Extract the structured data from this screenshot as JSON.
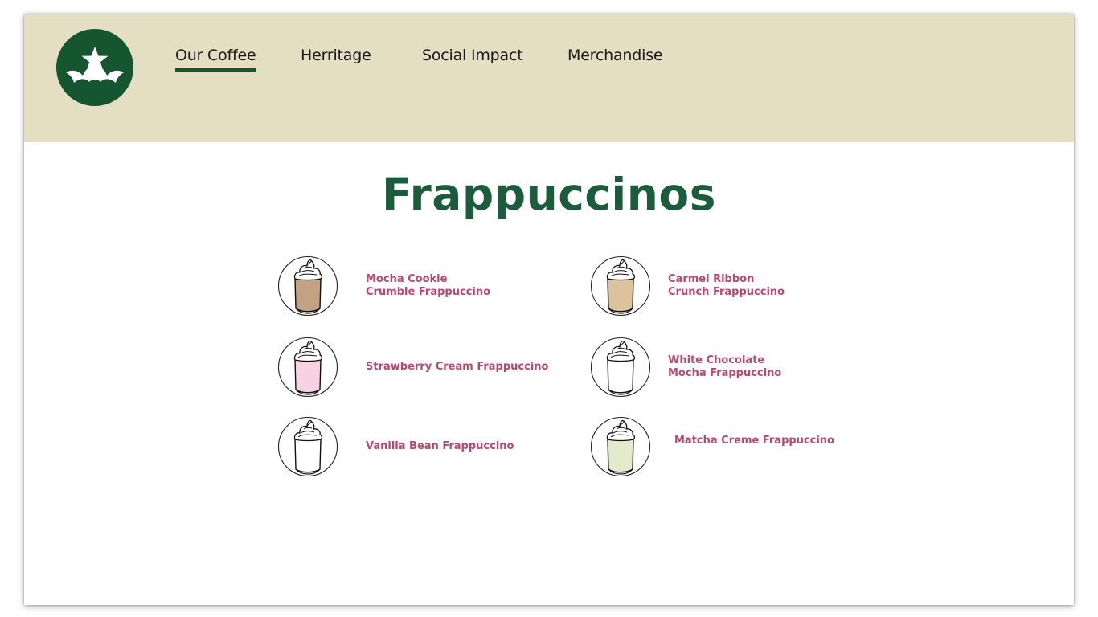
{
  "colors": {
    "header_bg": "#e4dfc2",
    "brand_green": "#155530",
    "title_green": "#1c5c3c",
    "drink_label": "#b44a6e"
  },
  "logo": {
    "icon": "crown-star-logo-icon"
  },
  "nav": {
    "items": [
      {
        "label": "Our Coffee",
        "active": true
      },
      {
        "label": "Herritage",
        "active": false
      },
      {
        "label": "Social Impact",
        "active": false
      },
      {
        "label": "Merchandise",
        "active": false
      }
    ]
  },
  "main": {
    "title": "Frappuccinos",
    "drinks": [
      {
        "line1": "Mocha Cookie",
        "line2": "Crumble Frappuccino",
        "fill": "#c3a283",
        "icon": "frappuccino-cup-icon"
      },
      {
        "line1": "Carmel Ribbon",
        "line2": "Crunch Frappuccino",
        "fill": "#dcc39c",
        "icon": "frappuccino-cup-icon"
      },
      {
        "line1": "Strawberry Cream Frappuccino",
        "line2": "",
        "fill": "#f7d3e2",
        "icon": "frappuccino-cup-icon"
      },
      {
        "line1": "White Chocolate",
        "line2": "Mocha Frappuccino",
        "fill": "#ffffff",
        "icon": "frappuccino-cup-icon"
      },
      {
        "line1": "Vanilla Bean Frappuccino",
        "line2": "",
        "fill": "#ffffff",
        "icon": "frappuccino-cup-icon"
      },
      {
        "line1": "Matcha Creme Frappuccino",
        "line2": "",
        "fill": "#e4ebcb",
        "icon": "frappuccino-cup-icon"
      }
    ]
  }
}
